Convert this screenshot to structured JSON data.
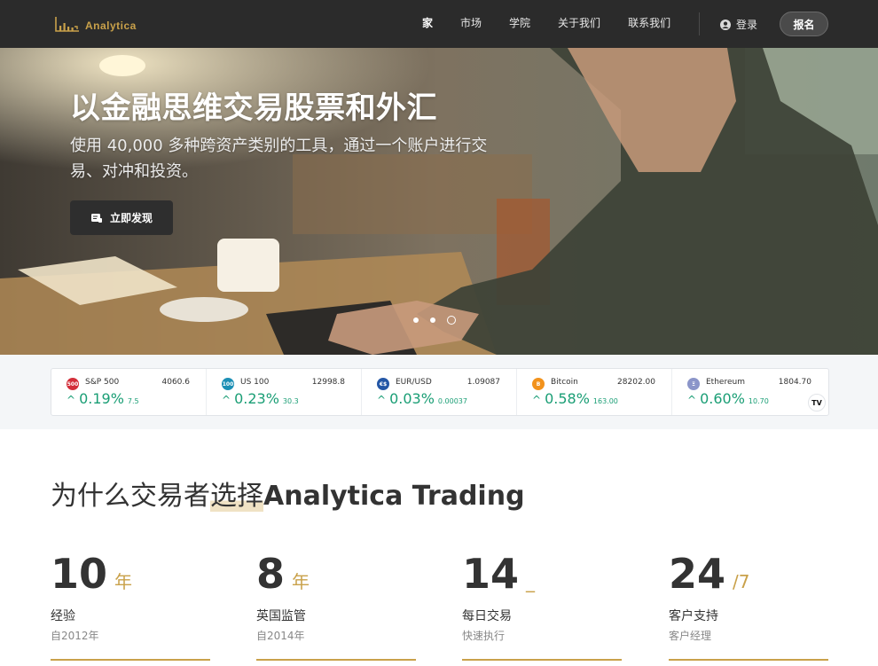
{
  "brand": {
    "name": "Analytica",
    "accent": "#c9a14a"
  },
  "nav": {
    "items": [
      {
        "label": "家"
      },
      {
        "label": "市场"
      },
      {
        "label": "学院"
      },
      {
        "label": "关于我们"
      },
      {
        "label": "联系我们"
      }
    ],
    "login_label": "登录",
    "signup_label": "报名"
  },
  "hero": {
    "title": "以金融思维交易股票和外汇",
    "subtitle": "使用 40,000 多种跨资产类别的工具，通过一个账户进行交易、对冲和投资。",
    "cta_label": "立即发现",
    "slides_count": 3,
    "active_slide": 3
  },
  "ticker": [
    {
      "icon": "500",
      "icon_color": "#d32f3a",
      "name": "S&P 500",
      "price": "4060.6",
      "pct": "0.19%",
      "abs": "7.5"
    },
    {
      "icon": "100",
      "icon_color": "#1c8fb5",
      "name": "US 100",
      "price": "12998.8",
      "pct": "0.23%",
      "abs": "30.3"
    },
    {
      "icon": "€$",
      "icon_color": "#2457a6",
      "name": "EUR/USD",
      "price": "1.09087",
      "pct": "0.03%",
      "abs": "0.00037"
    },
    {
      "icon": "B",
      "icon_color": "#f2921c",
      "name": "Bitcoin",
      "price": "28202.00",
      "pct": "0.58%",
      "abs": "163.00"
    },
    {
      "icon": "Ξ",
      "icon_color": "#8b95c9",
      "name": "Ethereum",
      "price": "1804.70",
      "pct": "0.60%",
      "abs": "10.70"
    }
  ],
  "ticker_badge": "TV",
  "why": {
    "title_prefix": "为什么交易者",
    "title_highlight": "选择",
    "title_brand": "Analytica Trading"
  },
  "stats": [
    {
      "number": "10",
      "unit": "年",
      "label": "经验",
      "sub": "自2012年"
    },
    {
      "number": "8",
      "unit": "年",
      "label": "英国监管",
      "sub": "自2014年"
    },
    {
      "number": "14",
      "unit": "_",
      "label": "每日交易",
      "sub": "快速执行"
    },
    {
      "number": "24",
      "unit": "/7",
      "label": "客户支持",
      "sub": "客户经理"
    }
  ]
}
